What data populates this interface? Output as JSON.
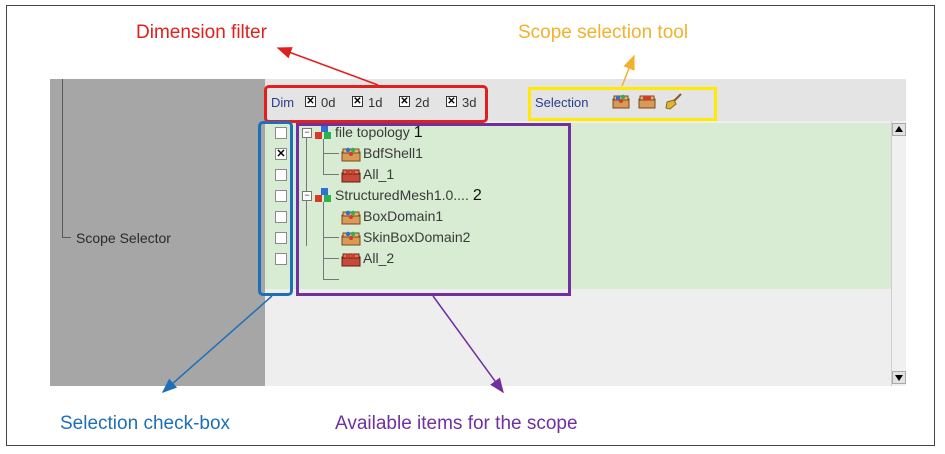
{
  "annotations": {
    "dimension_filter": "Dimension filter",
    "scope_selection_tool": "Scope selection tool",
    "selection_checkbox": "Selection check-box",
    "available_items": "Available items for the scope"
  },
  "left_panel": {
    "label": "Scope Selector"
  },
  "toolbar": {
    "dim_label": "Dim",
    "dims": [
      {
        "label": "0d",
        "checked": true
      },
      {
        "label": "1d",
        "checked": true
      },
      {
        "label": "2d",
        "checked": true
      },
      {
        "label": "3d",
        "checked": true
      }
    ],
    "selection_label": "Selection",
    "icons": [
      "select-all-icon",
      "clear-selection-icon",
      "broom-icon"
    ]
  },
  "tree": [
    {
      "label": "file topology",
      "number": "1",
      "checked": false,
      "icon": "topology-icon",
      "level": 0
    },
    {
      "label": "BdfShell1",
      "number": "",
      "checked": true,
      "icon": "domain-icon",
      "level": 1
    },
    {
      "label": "All_1",
      "number": "",
      "checked": false,
      "icon": "all-icon",
      "level": 1
    },
    {
      "label": "StructuredMesh1.0....",
      "number": "2",
      "checked": false,
      "icon": "topology-icon",
      "level": 0
    },
    {
      "label": "BoxDomain1",
      "number": "",
      "checked": false,
      "icon": "domain-icon",
      "level": 1
    },
    {
      "label": "SkinBoxDomain2",
      "number": "",
      "checked": false,
      "icon": "domain-icon",
      "level": 1
    },
    {
      "label": "All_2",
      "number": "",
      "checked": false,
      "icon": "all-icon",
      "level": 1
    }
  ],
  "colors": {
    "dimension_filter": "#e0201c",
    "scope_selection_tool": "#f2b12c",
    "selection_checkbox": "#1e6fb8",
    "available_items": "#7030a0",
    "tree_background": "#d7ecd2"
  }
}
